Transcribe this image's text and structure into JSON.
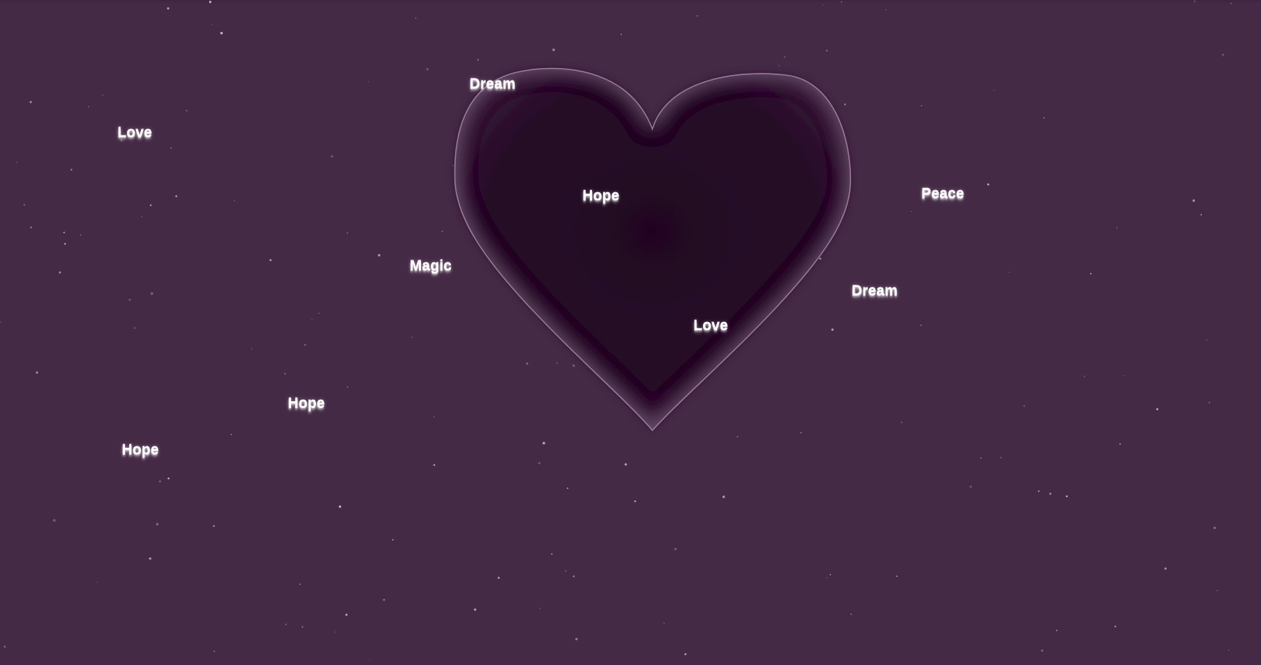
{
  "colors": {
    "background": "#452a46",
    "heart_fill": "#230723",
    "heart_outline": "#c8aac8",
    "text": "#ffffff",
    "star": "#d8c8da"
  },
  "icons": {
    "heart": "heart-icon"
  },
  "words": [
    {
      "id": "word-dream-1",
      "text": "Dream"
    },
    {
      "id": "word-love-1",
      "text": "Love"
    },
    {
      "id": "word-hope-1",
      "text": "Hope"
    },
    {
      "id": "word-peace-1",
      "text": "Peace"
    },
    {
      "id": "word-magic-1",
      "text": "Magic"
    },
    {
      "id": "word-dream-2",
      "text": "Dream"
    },
    {
      "id": "word-love-2",
      "text": "Love"
    },
    {
      "id": "word-hope-2",
      "text": "Hope"
    },
    {
      "id": "word-hope-3",
      "text": "Hope"
    }
  ]
}
